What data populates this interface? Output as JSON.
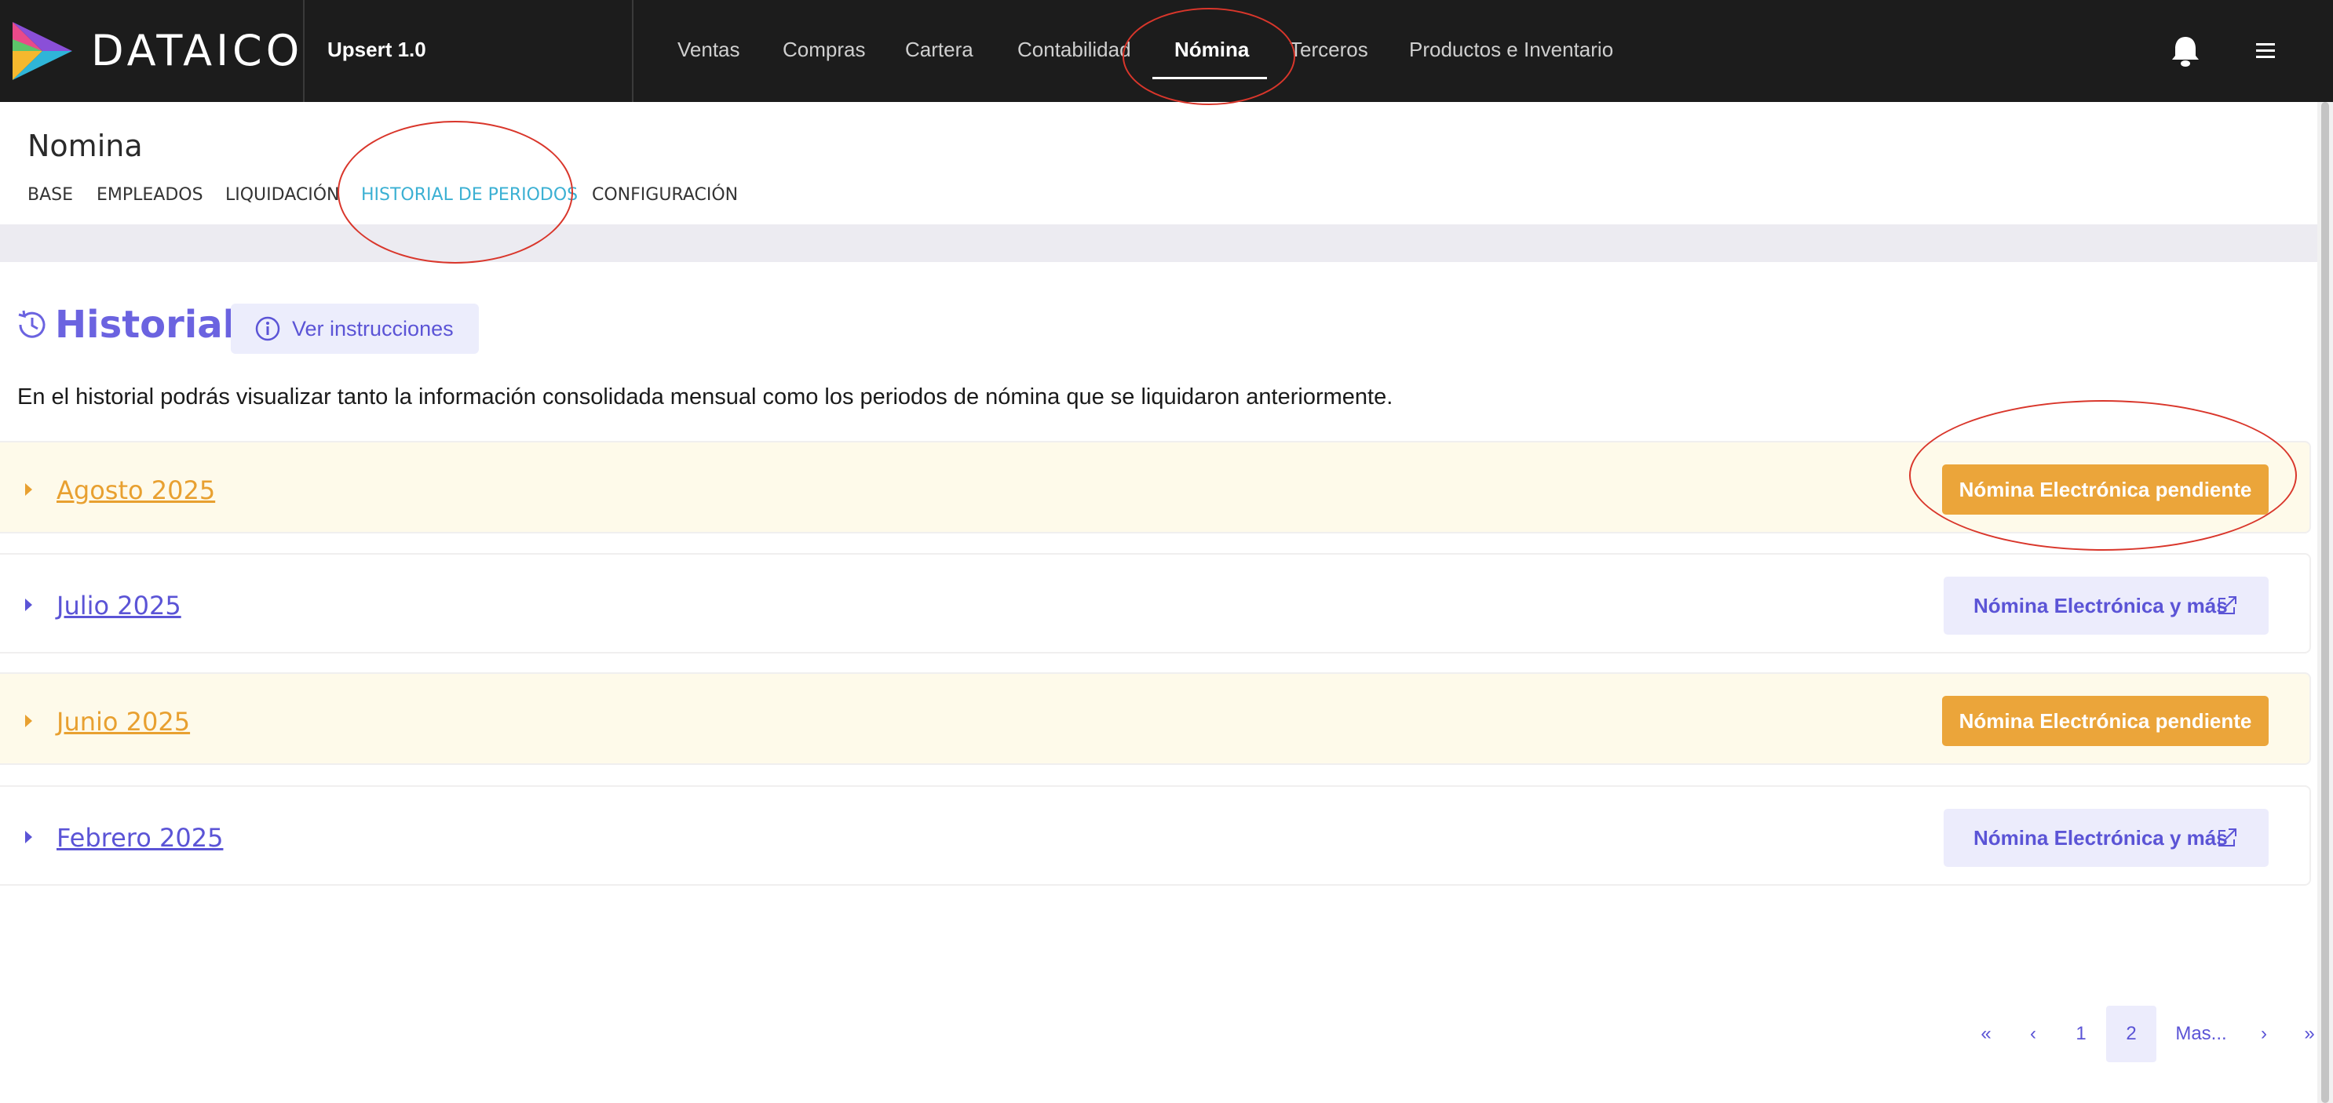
{
  "header": {
    "brand": "DATAICO",
    "company": "Upsert 1.0",
    "nav": [
      {
        "label": "Ventas"
      },
      {
        "label": "Compras"
      },
      {
        "label": "Cartera"
      },
      {
        "label": "Contabilidad"
      },
      {
        "label": "Nómina",
        "active": true
      },
      {
        "label": "Terceros"
      },
      {
        "label": "Productos e Inventario"
      }
    ],
    "icons": [
      "bell-icon",
      "hamburger-menu-icon"
    ]
  },
  "section": {
    "title": "Nomina",
    "tabs": [
      {
        "label": "BASE"
      },
      {
        "label": "EMPLEADOS"
      },
      {
        "label": "LIQUIDACIÓN"
      },
      {
        "label": "HISTORIAL DE PERIODOS",
        "active": true
      },
      {
        "label": "CONFIGURACIÓN"
      }
    ]
  },
  "historial": {
    "title": "Historial",
    "instructions_label": "Ver instrucciones",
    "description": "En el historial podrás visualizar tanto la información consolidada mensual como los periodos de nómina que se liquidaron anteriormente.",
    "periods": [
      {
        "label": "Agosto 2025",
        "status": "pending",
        "action": "Nómina Electrónica pendiente"
      },
      {
        "label": "Julio 2025",
        "status": "done",
        "action": "Nómina Electrónica y más"
      },
      {
        "label": "Junio 2025",
        "status": "pending",
        "action": "Nómina Electrónica pendiente"
      },
      {
        "label": "Febrero 2025",
        "status": "done",
        "action": "Nómina Electrónica y más"
      }
    ]
  },
  "pagination": {
    "first": "«",
    "prev": "‹",
    "pages": [
      "1",
      "2"
    ],
    "current": "2",
    "more": "Mas...",
    "next": "›",
    "last": "»"
  },
  "colors": {
    "topbar": "#1c1c1c",
    "accent": "#5b54d6",
    "active_tab": "#3bb0d3",
    "pending": "#eba53a",
    "pending_row": "#fefaea",
    "annotation": "#d9362b"
  }
}
